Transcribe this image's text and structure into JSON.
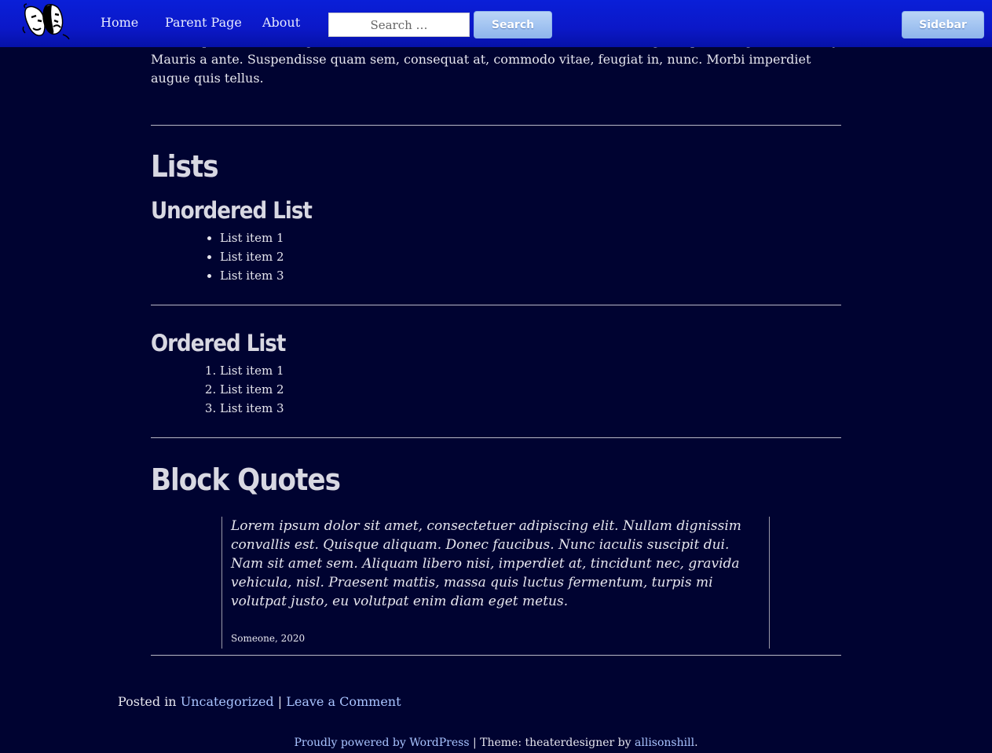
{
  "header": {
    "nav": [
      "Home",
      "Parent Page",
      "About"
    ],
    "search_placeholder": "Search …",
    "search_button": "Search",
    "sidebar_button": "Sidebar"
  },
  "content": {
    "intro_paragraph": "eu volutpat enim diam eget metus. Maecenas ornare tortor. Donec sed tellus eget sapien fringilla nonummy. Mauris a ante. Suspendisse quam sem, consequat at, commodo vitae, feugiat in, nunc. Morbi imperdiet augue quis tellus.",
    "lists_heading": "Lists",
    "unordered_heading": "Unordered List",
    "unordered_items": [
      "List item 1",
      "List item 2",
      "List item 3"
    ],
    "ordered_heading": "Ordered List",
    "ordered_items": [
      "List item 1",
      "List item 2",
      "List item 3"
    ],
    "blockquotes_heading": "Block Quotes",
    "quote_text": "Lorem ipsum dolor sit amet, consectetuer adipiscing elit. Nullam dignissim convallis est. Quisque aliquam. Donec faucibus. Nunc iaculis suscipit dui. Nam sit amet sem. Aliquam libero nisi, imperdiet at, tincidunt nec, gravida vehicula, nisl. Praesent mattis, massa quis luctus fermentum, turpis mi volutpat justo, eu volutpat enim diam eget metus.",
    "quote_cite": "Someone, 2020"
  },
  "post_meta": {
    "posted_in_label": "Posted in",
    "category_link": "Uncategorized",
    "separator": "|",
    "comment_link": "Leave a Comment"
  },
  "footer": {
    "powered_link": "Proudly powered by WordPress",
    "separator": "|",
    "theme_text": "Theme: theaterdesigner by",
    "author_link": "allisonshill",
    "end": "."
  },
  "colors": {
    "background": "#000331",
    "header": "#0b18c8",
    "link": "#a9c4ff",
    "button": "#8fb6ec"
  },
  "icons": [
    "theater-masks-logo-icon"
  ]
}
